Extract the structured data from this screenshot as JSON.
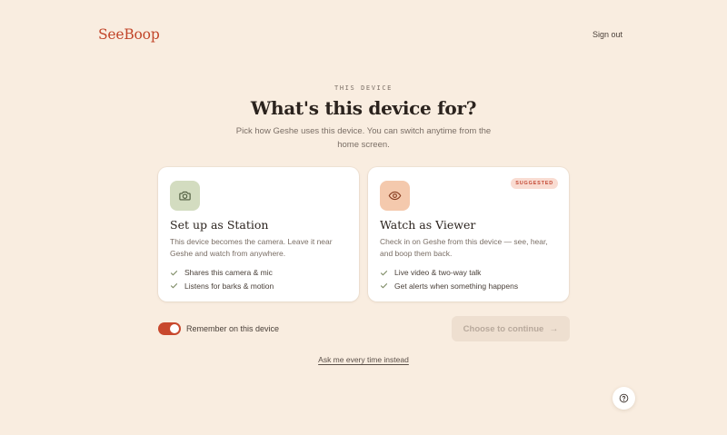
{
  "header": {
    "logo_text": "SeeBoop",
    "sign_out_label": "Sign out"
  },
  "intro": {
    "eyebrow": "THIS DEVICE",
    "title": "What's this device for?",
    "subtitle": "Pick how Geshe uses this device. You can switch anytime from the home screen."
  },
  "cards": [
    {
      "icon": "camera-icon",
      "title": "Set up as Station",
      "description": "This device becomes the camera. Leave it near Geshe and watch from anywhere.",
      "features": [
        "Shares this camera & mic",
        "Listens for barks & motion"
      ]
    },
    {
      "icon": "eye-icon",
      "badge": "SUGGESTED",
      "title": "Watch as Viewer",
      "description": "Check in on Geshe from this device — see, hear, and boop them back.",
      "features": [
        "Live video & two-way talk",
        "Get alerts when something happens"
      ]
    }
  ],
  "remember": {
    "label": "Remember on this device",
    "enabled": true
  },
  "continue_button": {
    "label": "Choose to continue",
    "icon": "arrow-right-icon"
  },
  "ask_link": "Ask me every time instead",
  "help_button": {
    "icon": "help-circle-icon"
  },
  "colors": {
    "background": "#f9ede0",
    "brand": "#c2462a",
    "station_icon_bg": "#d3dcc0",
    "viewer_icon_bg": "#f4c9ad",
    "badge_bg": "#f9dcd2",
    "badge_text": "#c44a36",
    "toggle_on": "#c8482d",
    "disabled_button_bg": "#eedfd0"
  }
}
